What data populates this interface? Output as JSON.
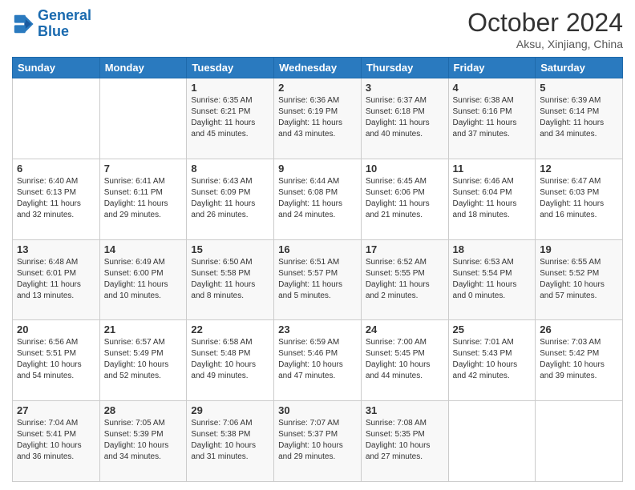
{
  "logo": {
    "line1": "General",
    "line2": "Blue"
  },
  "title": "October 2024",
  "subtitle": "Aksu, Xinjiang, China",
  "days_of_week": [
    "Sunday",
    "Monday",
    "Tuesday",
    "Wednesday",
    "Thursday",
    "Friday",
    "Saturday"
  ],
  "weeks": [
    [
      {
        "day": "",
        "sunrise": "",
        "sunset": "",
        "daylight": ""
      },
      {
        "day": "",
        "sunrise": "",
        "sunset": "",
        "daylight": ""
      },
      {
        "day": "1",
        "sunrise": "Sunrise: 6:35 AM",
        "sunset": "Sunset: 6:21 PM",
        "daylight": "Daylight: 11 hours and 45 minutes."
      },
      {
        "day": "2",
        "sunrise": "Sunrise: 6:36 AM",
        "sunset": "Sunset: 6:19 PM",
        "daylight": "Daylight: 11 hours and 43 minutes."
      },
      {
        "day": "3",
        "sunrise": "Sunrise: 6:37 AM",
        "sunset": "Sunset: 6:18 PM",
        "daylight": "Daylight: 11 hours and 40 minutes."
      },
      {
        "day": "4",
        "sunrise": "Sunrise: 6:38 AM",
        "sunset": "Sunset: 6:16 PM",
        "daylight": "Daylight: 11 hours and 37 minutes."
      },
      {
        "day": "5",
        "sunrise": "Sunrise: 6:39 AM",
        "sunset": "Sunset: 6:14 PM",
        "daylight": "Daylight: 11 hours and 34 minutes."
      }
    ],
    [
      {
        "day": "6",
        "sunrise": "Sunrise: 6:40 AM",
        "sunset": "Sunset: 6:13 PM",
        "daylight": "Daylight: 11 hours and 32 minutes."
      },
      {
        "day": "7",
        "sunrise": "Sunrise: 6:41 AM",
        "sunset": "Sunset: 6:11 PM",
        "daylight": "Daylight: 11 hours and 29 minutes."
      },
      {
        "day": "8",
        "sunrise": "Sunrise: 6:43 AM",
        "sunset": "Sunset: 6:09 PM",
        "daylight": "Daylight: 11 hours and 26 minutes."
      },
      {
        "day": "9",
        "sunrise": "Sunrise: 6:44 AM",
        "sunset": "Sunset: 6:08 PM",
        "daylight": "Daylight: 11 hours and 24 minutes."
      },
      {
        "day": "10",
        "sunrise": "Sunrise: 6:45 AM",
        "sunset": "Sunset: 6:06 PM",
        "daylight": "Daylight: 11 hours and 21 minutes."
      },
      {
        "day": "11",
        "sunrise": "Sunrise: 6:46 AM",
        "sunset": "Sunset: 6:04 PM",
        "daylight": "Daylight: 11 hours and 18 minutes."
      },
      {
        "day": "12",
        "sunrise": "Sunrise: 6:47 AM",
        "sunset": "Sunset: 6:03 PM",
        "daylight": "Daylight: 11 hours and 16 minutes."
      }
    ],
    [
      {
        "day": "13",
        "sunrise": "Sunrise: 6:48 AM",
        "sunset": "Sunset: 6:01 PM",
        "daylight": "Daylight: 11 hours and 13 minutes."
      },
      {
        "day": "14",
        "sunrise": "Sunrise: 6:49 AM",
        "sunset": "Sunset: 6:00 PM",
        "daylight": "Daylight: 11 hours and 10 minutes."
      },
      {
        "day": "15",
        "sunrise": "Sunrise: 6:50 AM",
        "sunset": "Sunset: 5:58 PM",
        "daylight": "Daylight: 11 hours and 8 minutes."
      },
      {
        "day": "16",
        "sunrise": "Sunrise: 6:51 AM",
        "sunset": "Sunset: 5:57 PM",
        "daylight": "Daylight: 11 hours and 5 minutes."
      },
      {
        "day": "17",
        "sunrise": "Sunrise: 6:52 AM",
        "sunset": "Sunset: 5:55 PM",
        "daylight": "Daylight: 11 hours and 2 minutes."
      },
      {
        "day": "18",
        "sunrise": "Sunrise: 6:53 AM",
        "sunset": "Sunset: 5:54 PM",
        "daylight": "Daylight: 11 hours and 0 minutes."
      },
      {
        "day": "19",
        "sunrise": "Sunrise: 6:55 AM",
        "sunset": "Sunset: 5:52 PM",
        "daylight": "Daylight: 10 hours and 57 minutes."
      }
    ],
    [
      {
        "day": "20",
        "sunrise": "Sunrise: 6:56 AM",
        "sunset": "Sunset: 5:51 PM",
        "daylight": "Daylight: 10 hours and 54 minutes."
      },
      {
        "day": "21",
        "sunrise": "Sunrise: 6:57 AM",
        "sunset": "Sunset: 5:49 PM",
        "daylight": "Daylight: 10 hours and 52 minutes."
      },
      {
        "day": "22",
        "sunrise": "Sunrise: 6:58 AM",
        "sunset": "Sunset: 5:48 PM",
        "daylight": "Daylight: 10 hours and 49 minutes."
      },
      {
        "day": "23",
        "sunrise": "Sunrise: 6:59 AM",
        "sunset": "Sunset: 5:46 PM",
        "daylight": "Daylight: 10 hours and 47 minutes."
      },
      {
        "day": "24",
        "sunrise": "Sunrise: 7:00 AM",
        "sunset": "Sunset: 5:45 PM",
        "daylight": "Daylight: 10 hours and 44 minutes."
      },
      {
        "day": "25",
        "sunrise": "Sunrise: 7:01 AM",
        "sunset": "Sunset: 5:43 PM",
        "daylight": "Daylight: 10 hours and 42 minutes."
      },
      {
        "day": "26",
        "sunrise": "Sunrise: 7:03 AM",
        "sunset": "Sunset: 5:42 PM",
        "daylight": "Daylight: 10 hours and 39 minutes."
      }
    ],
    [
      {
        "day": "27",
        "sunrise": "Sunrise: 7:04 AM",
        "sunset": "Sunset: 5:41 PM",
        "daylight": "Daylight: 10 hours and 36 minutes."
      },
      {
        "day": "28",
        "sunrise": "Sunrise: 7:05 AM",
        "sunset": "Sunset: 5:39 PM",
        "daylight": "Daylight: 10 hours and 34 minutes."
      },
      {
        "day": "29",
        "sunrise": "Sunrise: 7:06 AM",
        "sunset": "Sunset: 5:38 PM",
        "daylight": "Daylight: 10 hours and 31 minutes."
      },
      {
        "day": "30",
        "sunrise": "Sunrise: 7:07 AM",
        "sunset": "Sunset: 5:37 PM",
        "daylight": "Daylight: 10 hours and 29 minutes."
      },
      {
        "day": "31",
        "sunrise": "Sunrise: 7:08 AM",
        "sunset": "Sunset: 5:35 PM",
        "daylight": "Daylight: 10 hours and 27 minutes."
      },
      {
        "day": "",
        "sunrise": "",
        "sunset": "",
        "daylight": ""
      },
      {
        "day": "",
        "sunrise": "",
        "sunset": "",
        "daylight": ""
      }
    ]
  ]
}
